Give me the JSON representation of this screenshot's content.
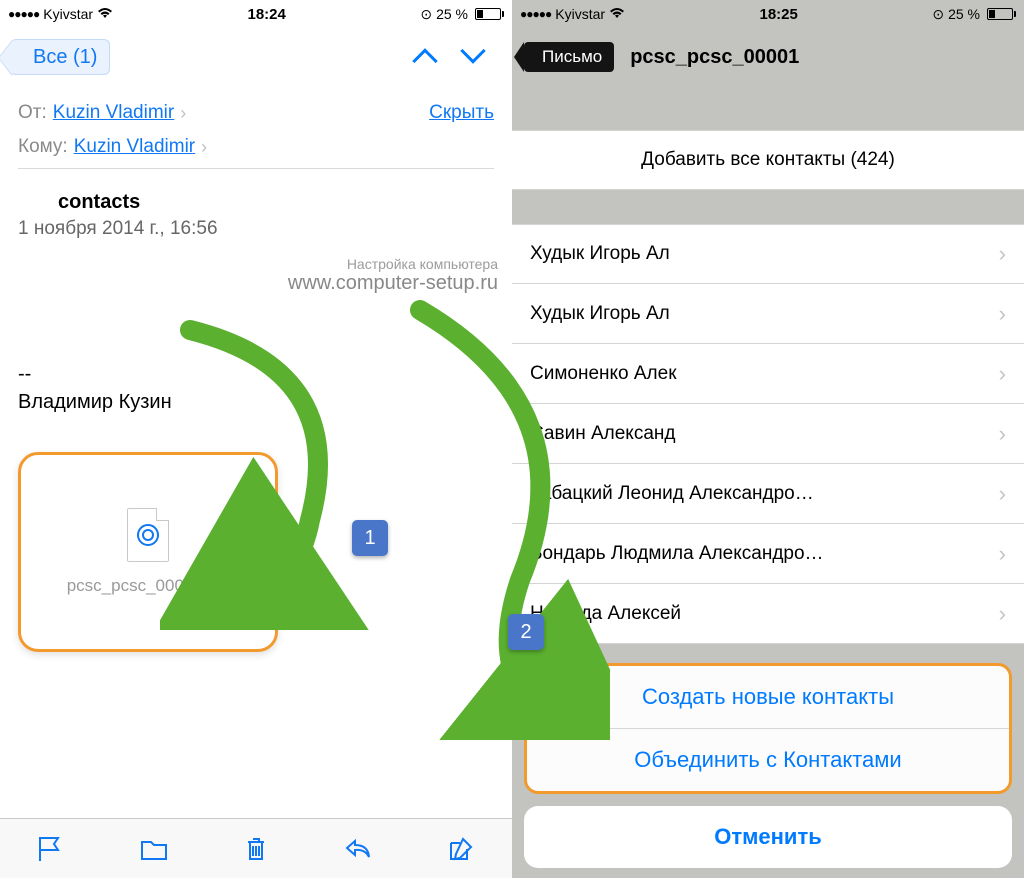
{
  "left": {
    "status": {
      "carrier": "Kyivstar",
      "time": "18:24",
      "battery_pct": "25 %"
    },
    "nav": {
      "back_label": "Все (1)"
    },
    "mail": {
      "from_label": "От:",
      "from_value": "Kuzin Vladimir",
      "hide_label": "Скрыть",
      "to_label": "Кому:",
      "to_value": "Kuzin Vladimir",
      "subject": "contacts",
      "date": "1 ноября 2014 г., 16:56",
      "separator": "--",
      "signature": "Владимир Кузин",
      "attachment_name": "pcsc_pcsc_00001.vcf"
    },
    "watermark": {
      "line1": "Настройка компьютера",
      "line2": "www.computer-setup.ru"
    }
  },
  "right": {
    "status": {
      "carrier": "Kyivstar",
      "time": "18:25",
      "battery_pct": "25 %"
    },
    "nav": {
      "back_label": "Письмо",
      "title": "pcsc_pcsc_00001"
    },
    "add_all_label": "Добавить все контакты (424)",
    "contacts": [
      "Худык Игорь Ал",
      "Худык Игорь Ал",
      "Симоненко Алек",
      "Савин Александ",
      "Табацкий Леонид Александро…",
      "Бондарь Людмила Александро…",
      "Нищида Алексей"
    ],
    "sheet": {
      "create_label": "Создать новые контакты",
      "merge_label": "Объединить с Контактами",
      "cancel_label": "Отменить"
    }
  },
  "badges": {
    "one": "1",
    "two": "2"
  }
}
